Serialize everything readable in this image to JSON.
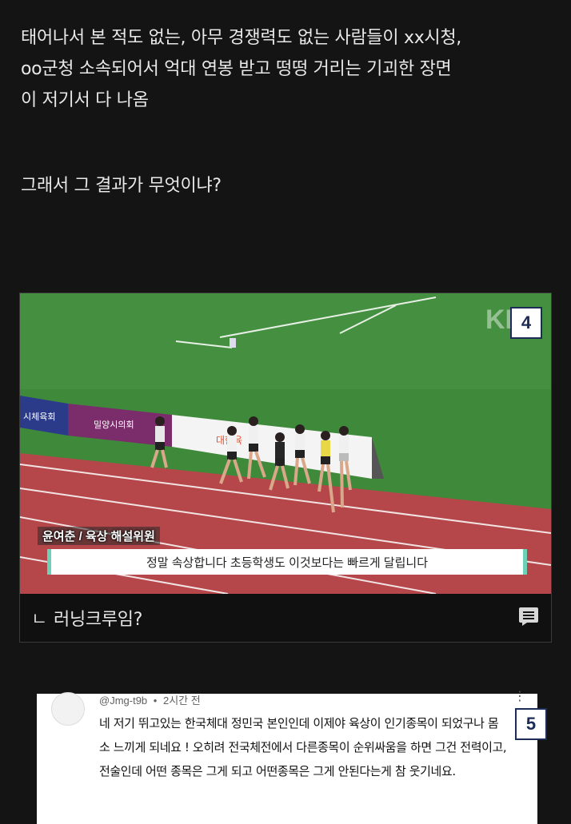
{
  "post": {
    "paragraph1": "태어나서 본 적도 없는, 아무 경쟁력도 없는 사람들이 xx시청,\noo군청 소속되어서 억대 연봉 받고 떵떵 거리는 기괴한 장면\n이 저기서 다 나옴",
    "paragraph2": "그래서 그 결과가 무엇이냐?"
  },
  "embed": {
    "badge": "4",
    "broadcast_logo": "KBS",
    "banner_1": "시체육회",
    "banner_2": "밀양시의회",
    "banner_3": "대한육",
    "caption_name": "윤여춘 / 육상 해설위원",
    "caption_subtitle": "정말 속상합니다 초등학생도 이것보다는 빠르게 달립니다",
    "reply_mark": "ㄴ",
    "reply_text": "러닝크루임?",
    "comment_icon": "comment-icon"
  },
  "yt_comment": {
    "badge": "5",
    "author": "@Jmg-t9b",
    "separator": "•",
    "time": "2시간 전",
    "body": "네 저기 뛰고있는 한국체대 정민국 본인인데 이제야 육상이 인기종목이 되었구나 몸소 느끼게 되네요 ! 오히려 전국체전에서 다른종목이 순위싸움을 하면 그건 전력이고, 전술인데 어떤 종목은 그게 되고 어떤종목은 그게 안된다는게 참 웃기네요."
  },
  "colors": {
    "background": "#141414",
    "grass": "#3f8a3a",
    "track": "#b5474a",
    "subtitle_accent": "#6fd0b8",
    "badge_border": "#1d2b57"
  }
}
